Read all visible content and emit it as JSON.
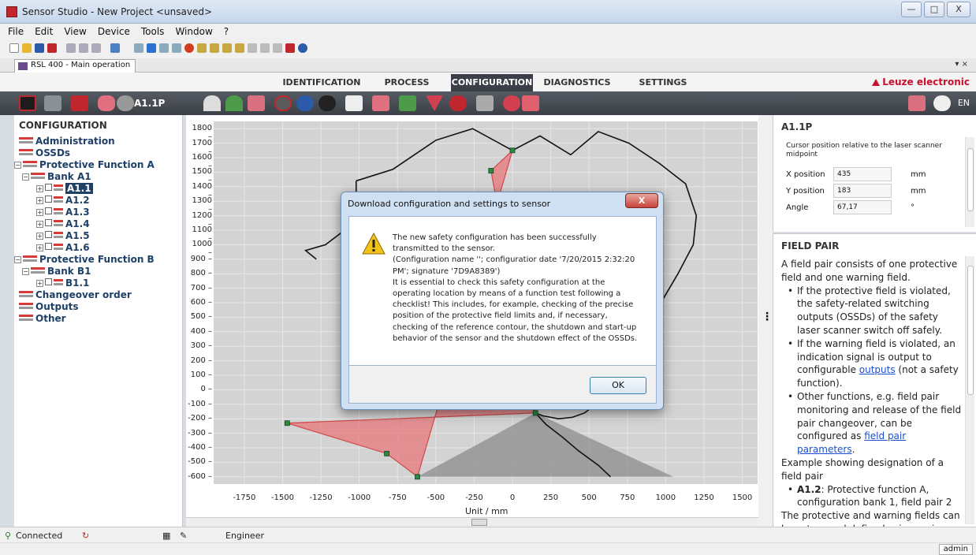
{
  "window": {
    "title": "Sensor Studio - New Project  <unsaved>",
    "controls": {
      "minimize": "—",
      "maximize": "□",
      "close": "X"
    }
  },
  "menu": [
    "File",
    "Edit",
    "View",
    "Device",
    "Tools",
    "Window",
    "?"
  ],
  "document_tab": {
    "label": "RSL 400 - Main operation",
    "controls": "▾ ×"
  },
  "nav": {
    "tabs": [
      {
        "label": "IDENTIFICATION"
      },
      {
        "label": "PROCESS"
      },
      {
        "label": "CONFIGURATION",
        "active": true
      },
      {
        "label": "DIAGNOSTICS"
      },
      {
        "label": "SETTINGS"
      }
    ],
    "brand": "Leuze electronic",
    "brand_color": "#c8102e"
  },
  "darkbar": {
    "current_item": "A1.1P",
    "language": "EN"
  },
  "config_tree": {
    "title": "CONFIGURATION",
    "items": [
      {
        "label": "Administration"
      },
      {
        "label": "OSSDs"
      },
      {
        "label": "Protective Function A"
      },
      {
        "label": "Bank A1"
      },
      {
        "label": "A1.1"
      },
      {
        "label": "A1.2"
      },
      {
        "label": "A1.3"
      },
      {
        "label": "A1.4"
      },
      {
        "label": "A1.5"
      },
      {
        "label": "A1.6"
      },
      {
        "label": "Protective Function B"
      },
      {
        "label": "Bank B1"
      },
      {
        "label": "B1.1"
      },
      {
        "label": "Changeover order"
      },
      {
        "label": "Outputs"
      },
      {
        "label": "Other"
      }
    ]
  },
  "chart_data": {
    "type": "scatter",
    "xlabel": "Unit / mm",
    "ylabel": "",
    "xlim": [
      -1950,
      1600
    ],
    "ylim": [
      -650,
      1850
    ],
    "xticks": [
      -1750,
      -1500,
      -1250,
      -1000,
      -750,
      -500,
      -250,
      0,
      250,
      500,
      750,
      1000,
      1250,
      1500
    ],
    "yticks": [
      1800,
      1700,
      1600,
      1500,
      1400,
      1300,
      1200,
      1100,
      1000,
      900,
      800,
      700,
      600,
      500,
      400,
      300,
      200,
      100,
      0,
      -100,
      -200,
      -300,
      -400,
      -500,
      -600
    ],
    "grid": true,
    "protective_field": [
      [
        -1470,
        -230
      ],
      [
        -820,
        -440
      ],
      [
        -620,
        -600
      ],
      [
        0,
        1650
      ],
      [
        -140,
        1510
      ]
    ],
    "vertices": [
      [
        0,
        1650
      ],
      [
        -140,
        1510
      ],
      [
        -1470,
        -230
      ],
      [
        -820,
        -440
      ],
      [
        -620,
        -600
      ],
      [
        150,
        -160
      ]
    ],
    "colors": {
      "field_fill": "#e8787c",
      "field_stroke": "#d04848",
      "plot_bg": "#d3d3d3",
      "shadow": "#8c8c8c",
      "vertex": "#2d8a3a"
    }
  },
  "details": {
    "title": "A1.1P",
    "subtitle": "Cursor position relative to the laser scanner midpoint",
    "fields": [
      {
        "label": "X position",
        "value": "435",
        "unit": "mm"
      },
      {
        "label": "Y position",
        "value": "183",
        "unit": "mm"
      },
      {
        "label": "Angle",
        "value": "67,17",
        "unit": "°"
      }
    ]
  },
  "help": {
    "title": "FIELD PAIR",
    "intro": "A field pair consists of one protective field and one warning field.",
    "bullets": [
      "If the protective field is violated, the safety-related switching outputs (OSSDs) of the safety laser scanner switch off safely.",
      "If the warning field is violated, an indication signal is output to configurable ",
      "outputs",
      " (not a safety function).",
      "Other functions, e.g. field pair monitoring and release of the field pair changeover, can be configured as ",
      "field pair parameters",
      "."
    ],
    "example": "Example showing designation of a field pair",
    "example_bold": "A1.2",
    "example_text": ": Protective function A, configuration bank 1, field pair 2",
    "footer": "The protective and warning fields can be set up and defined using various"
  },
  "status": {
    "connected": "Connected",
    "role": "Engineer",
    "user": "admin"
  },
  "dialog": {
    "title": "Download configuration and settings to sensor",
    "close": "X",
    "message": "The new safety configuration has been successfully transmitted to the sensor.\n(Configuration name ''; configuratior date '7/20/2015 2:32:20 PM'; signature '7D9A8389')\nIt is essential to check this safety configuration at the operating location by means of a function test following a checklist! This includes, for example, checking of the precise position of the protective field limits and, if necessary, checking of the reference contour, the shutdown and start-up behavior of the sensor and the shutdown effect of the OSSDs.",
    "ok": "OK"
  }
}
